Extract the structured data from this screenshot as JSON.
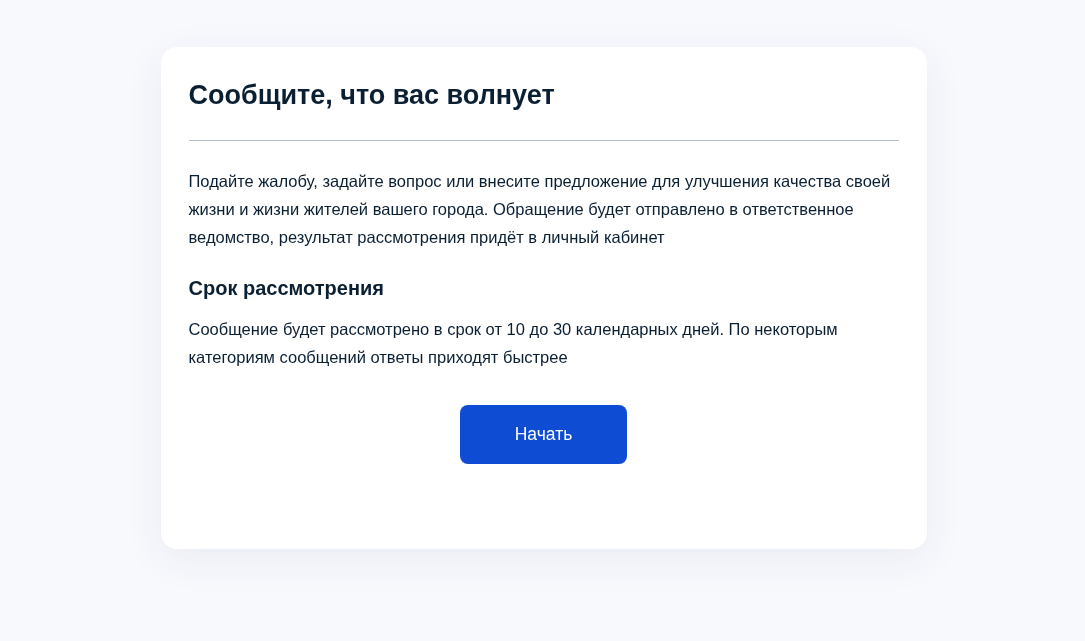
{
  "card": {
    "title": "Сообщите, что вас волнует",
    "description": "Подайте жалобу, задайте вопрос или внесите предложение для улучшения качества своей жизни и жизни жителей вашего города. Обращение будет отправлено в ответственное ведомство, результат рассмотрения придёт в личный кабинет",
    "section_title": "Срок рассмотрения",
    "section_text": "Сообщение будет рассмотрено в срок от 10 до 30 календарных дней. По некоторым категориям сообщений ответы приходят быстрее",
    "button": "Начать"
  }
}
